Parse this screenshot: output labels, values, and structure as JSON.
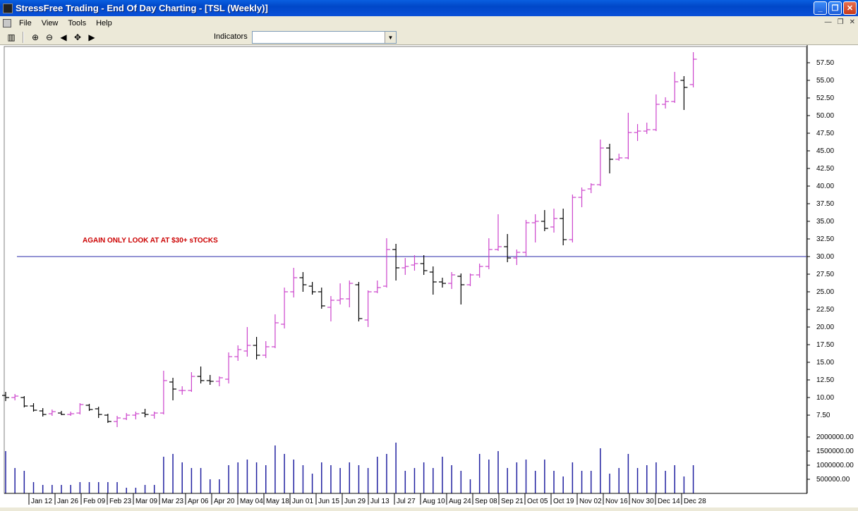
{
  "window": {
    "title": "StressFree Trading - End Of Day Charting - [TSL (Weekly)]"
  },
  "menu": [
    "File",
    "View",
    "Tools",
    "Help"
  ],
  "toolbar": {
    "indicators_label": "Indicators",
    "indicators_value": ""
  },
  "annotation": "AGAIN ONLY LOOK AT AT $30+ sTOCKS",
  "colors": {
    "up": "#cc44cc",
    "down": "#000000",
    "volume": "#2020a0",
    "line": "#2828a8",
    "annotation": "#cc0000"
  },
  "chart_data": {
    "type": "bar",
    "price_ticks": [
      "57.50",
      "55.00",
      "52.50",
      "50.00",
      "47.50",
      "45.00",
      "42.50",
      "40.00",
      "37.50",
      "35.00",
      "32.50",
      "30.00",
      "27.50",
      "25.00",
      "22.50",
      "20.00",
      "17.50",
      "15.00",
      "12.50",
      "10.00",
      "7.50"
    ],
    "volume_ticks": [
      "2000000.00",
      "1500000.00",
      "1000000.00",
      "500000.00"
    ],
    "x_labels": [
      "Jan 12",
      "Jan 26",
      "Feb 09",
      "Feb 23",
      "Mar 09",
      "Mar 23",
      "Apr 06",
      "Apr 20",
      "May 04",
      "May 18",
      "Jun 01",
      "Jun 15",
      "Jun 29",
      "Jul 13",
      "Jul 27",
      "Aug 10",
      "Aug 24",
      "Sep 08",
      "Sep 21",
      "Oct 05",
      "Oct 19",
      "Nov 02",
      "Nov 16",
      "Nov 30",
      "Dec 14",
      "Dec 28"
    ],
    "horizontal_line": 30.0,
    "ylim": [
      0,
      60
    ],
    "bars": [
      [
        10.3,
        10.8,
        9.5,
        10.0
      ],
      [
        10.0,
        10.5,
        9.6,
        10.2
      ],
      [
        10.0,
        10.2,
        8.6,
        8.8
      ],
      [
        8.8,
        9.2,
        8.0,
        8.2
      ],
      [
        8.1,
        8.5,
        7.3,
        7.6
      ],
      [
        7.7,
        8.3,
        7.4,
        8.0
      ],
      [
        7.8,
        8.1,
        7.5,
        7.6
      ],
      [
        7.6,
        8.0,
        7.4,
        7.7
      ],
      [
        7.8,
        9.2,
        7.6,
        9.0
      ],
      [
        8.9,
        9.1,
        8.1,
        8.3
      ],
      [
        8.4,
        8.7,
        7.1,
        7.6
      ],
      [
        7.5,
        7.7,
        6.4,
        6.6
      ],
      [
        6.6,
        7.4,
        5.8,
        7.1
      ],
      [
        7.0,
        7.8,
        6.8,
        7.5
      ],
      [
        7.5,
        8.0,
        6.9,
        7.7
      ],
      [
        7.8,
        8.4,
        7.2,
        7.6
      ],
      [
        7.5,
        8.0,
        7.0,
        7.8
      ],
      [
        7.8,
        13.8,
        7.6,
        12.4
      ],
      [
        12.2,
        12.8,
        9.6,
        11.2
      ],
      [
        11.0,
        11.6,
        10.4,
        11.0
      ],
      [
        11.0,
        13.6,
        10.8,
        13.0
      ],
      [
        13.0,
        14.4,
        12.0,
        12.4
      ],
      [
        12.4,
        13.2,
        11.8,
        12.3
      ],
      [
        12.3,
        13.0,
        11.6,
        12.8
      ],
      [
        12.6,
        16.4,
        12.0,
        15.8
      ],
      [
        15.8,
        17.4,
        15.2,
        16.8
      ],
      [
        16.6,
        20.0,
        15.8,
        17.4
      ],
      [
        17.4,
        18.6,
        15.4,
        16.0
      ],
      [
        16.0,
        18.0,
        15.6,
        17.2
      ],
      [
        17.2,
        21.8,
        17.0,
        20.6
      ],
      [
        20.4,
        25.6,
        19.8,
        25.0
      ],
      [
        25.0,
        28.4,
        24.2,
        27.0
      ],
      [
        27.0,
        27.8,
        25.0,
        26.0
      ],
      [
        25.8,
        26.4,
        24.6,
        25.0
      ],
      [
        25.0,
        25.6,
        22.6,
        23.0
      ],
      [
        22.8,
        24.4,
        20.8,
        23.8
      ],
      [
        23.8,
        26.2,
        23.2,
        24.0
      ],
      [
        24.0,
        26.6,
        22.8,
        26.2
      ],
      [
        26.0,
        26.4,
        20.8,
        21.2
      ],
      [
        21.0,
        25.2,
        20.0,
        25.0
      ],
      [
        25.0,
        26.6,
        24.8,
        25.6
      ],
      [
        25.8,
        32.6,
        25.6,
        31.0
      ],
      [
        31.0,
        31.8,
        26.6,
        28.4
      ],
      [
        28.4,
        29.8,
        27.4,
        28.6
      ],
      [
        28.8,
        30.2,
        28.0,
        29.0
      ],
      [
        29.0,
        30.2,
        27.4,
        28.0
      ],
      [
        27.8,
        28.6,
        24.6,
        26.4
      ],
      [
        26.4,
        27.0,
        25.6,
        26.2
      ],
      [
        26.2,
        27.8,
        25.4,
        27.4
      ],
      [
        27.2,
        27.6,
        23.2,
        26.0
      ],
      [
        26.0,
        27.6,
        25.8,
        27.4
      ],
      [
        27.4,
        29.0,
        27.0,
        28.6
      ],
      [
        28.6,
        32.6,
        28.2,
        31.0
      ],
      [
        31.0,
        36.0,
        30.8,
        31.4
      ],
      [
        31.4,
        33.2,
        29.2,
        29.8
      ],
      [
        29.8,
        31.0,
        28.8,
        30.6
      ],
      [
        30.6,
        35.2,
        30.0,
        34.8
      ],
      [
        34.8,
        36.0,
        32.0,
        35.0
      ],
      [
        35.0,
        36.6,
        33.6,
        34.0
      ],
      [
        34.2,
        36.8,
        33.4,
        35.4
      ],
      [
        35.4,
        36.8,
        31.6,
        32.4
      ],
      [
        32.4,
        38.8,
        32.0,
        38.4
      ],
      [
        38.4,
        39.8,
        37.0,
        39.4
      ],
      [
        39.6,
        40.4,
        39.0,
        40.2
      ],
      [
        40.2,
        46.6,
        40.0,
        45.4
      ],
      [
        45.4,
        46.0,
        41.8,
        43.8
      ],
      [
        43.8,
        44.6,
        43.6,
        44.0
      ],
      [
        44.0,
        50.4,
        43.8,
        47.6
      ],
      [
        47.6,
        48.8,
        46.4,
        47.8
      ],
      [
        47.8,
        49.0,
        47.4,
        48.0
      ],
      [
        48.0,
        53.0,
        47.8,
        51.6
      ],
      [
        51.6,
        52.6,
        51.0,
        52.0
      ],
      [
        52.0,
        56.2,
        51.8,
        54.8
      ],
      [
        55.0,
        55.6,
        50.8,
        54.0
      ],
      [
        54.4,
        59.0,
        54.0,
        58.0
      ]
    ],
    "volume": [
      1.5,
      0.9,
      0.8,
      0.4,
      0.3,
      0.3,
      0.3,
      0.3,
      0.4,
      0.4,
      0.4,
      0.4,
      0.4,
      0.2,
      0.2,
      0.3,
      0.3,
      1.3,
      1.4,
      1.1,
      0.9,
      0.9,
      0.5,
      0.5,
      1.0,
      1.1,
      1.2,
      1.1,
      1.0,
      1.7,
      1.4,
      1.2,
      1.0,
      0.7,
      1.1,
      1.0,
      0.9,
      1.1,
      1.0,
      0.9,
      1.3,
      1.4,
      1.8,
      0.8,
      0.9,
      1.1,
      0.9,
      1.3,
      1.0,
      0.8,
      0.5,
      1.4,
      1.2,
      1.5,
      0.9,
      1.1,
      1.2,
      0.8,
      1.2,
      0.8,
      0.6,
      1.1,
      0.8,
      0.8,
      1.6,
      0.7,
      0.9,
      1.4,
      0.9,
      1.0,
      1.1,
      0.8,
      1.0,
      0.6,
      1.0
    ]
  }
}
